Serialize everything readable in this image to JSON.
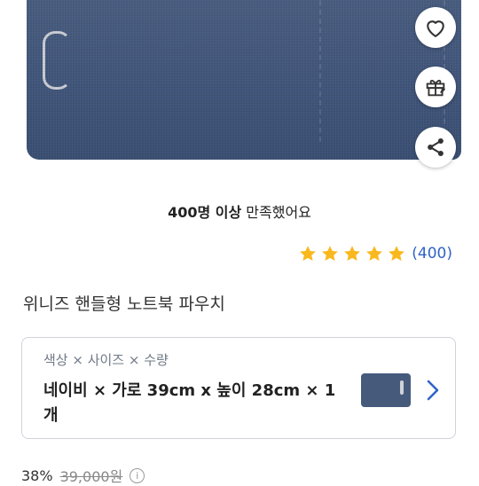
{
  "satisfaction": {
    "strong": "400명 이상",
    "rest": " 만족했어요"
  },
  "rating": {
    "stars": 5,
    "max": 5,
    "review_count": "(400)",
    "star_color": "#f9b81e"
  },
  "product": {
    "title": "위니즈 핸들형 노트북 파우치"
  },
  "option": {
    "label": "색상 × 사이즈 × 수량",
    "value": "네이비 × 가로 39cm x 높이 28cm × 1개"
  },
  "price": {
    "discount": "38%",
    "original": "39,000원"
  },
  "icons": [
    "heart-icon",
    "gift-icon",
    "share-icon",
    "chevron-right-icon",
    "info-icon"
  ],
  "colors": {
    "accent_blue": "#2f64c8",
    "bag_navy": "#42567a"
  }
}
